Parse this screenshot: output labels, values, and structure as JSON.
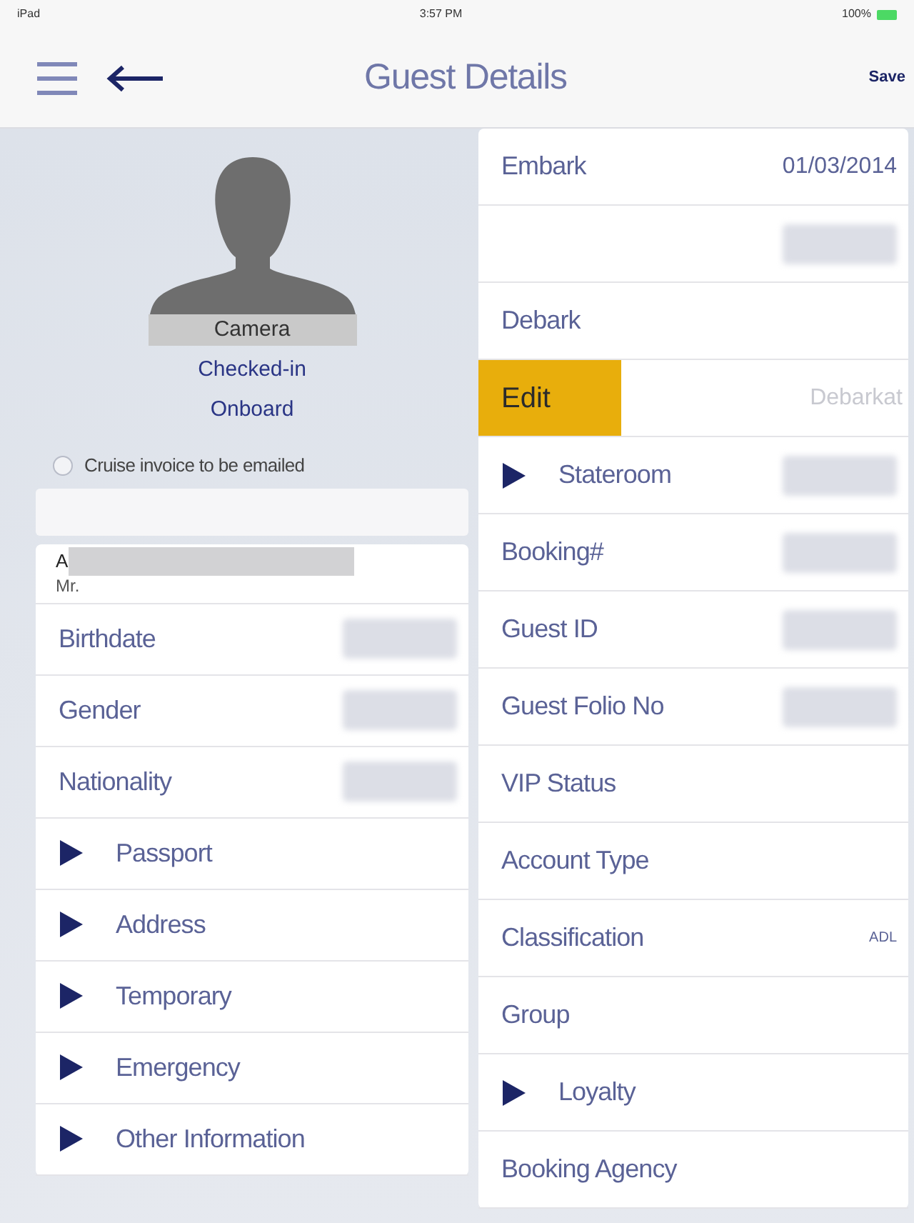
{
  "status_bar": {
    "device": "iPad",
    "time": "3:57 PM",
    "battery": "100%"
  },
  "nav_bar": {
    "title": "Guest Details",
    "save": "Save"
  },
  "profile": {
    "camera": "Camera",
    "statuses": [
      "Checked-in",
      "Onboard"
    ],
    "invoice_option": {
      "label": "Cruise invoice to be emailed",
      "checked": false
    }
  },
  "guest_name": {
    "name": "A",
    "redacted": true,
    "title": "Mr."
  },
  "left_rows": [
    {
      "kind": "field",
      "label": "Birthdate",
      "redacted": true
    },
    {
      "kind": "field",
      "label": "Gender",
      "redacted": true
    },
    {
      "kind": "field",
      "label": "Nationality",
      "redacted": true
    },
    {
      "kind": "expander",
      "label": "Passport",
      "expanded": false
    },
    {
      "kind": "expander",
      "label": "Address",
      "expanded": false
    },
    {
      "kind": "expander",
      "label": "Temporary",
      "expanded": false
    },
    {
      "kind": "expander",
      "label": "Emergency",
      "expanded": false
    },
    {
      "kind": "expander",
      "label": "Other Information",
      "expanded": false
    }
  ],
  "right_rows": [
    {
      "kind": "field",
      "label": "Embark",
      "value": "01/03/2014"
    },
    {
      "kind": "field",
      "redacted": true
    },
    {
      "kind": "field",
      "label": "Debark"
    },
    {
      "kind": "edit",
      "action": "Edit",
      "value": "Debarkat"
    },
    {
      "kind": "expander",
      "label": "Stateroom",
      "expanded": false,
      "redacted": true
    },
    {
      "kind": "field",
      "label": "Booking#",
      "redacted": true
    },
    {
      "kind": "field",
      "label": "Guest ID",
      "redacted": true
    },
    {
      "kind": "field",
      "label": "Guest Folio No",
      "redacted": true
    },
    {
      "kind": "field",
      "label": "VIP Status"
    },
    {
      "kind": "field",
      "label": "Account Type"
    },
    {
      "kind": "field",
      "label": "Classification",
      "value": "ADL"
    },
    {
      "kind": "field",
      "label": "Group"
    },
    {
      "kind": "expander",
      "label": "Loyalty",
      "expanded": false
    },
    {
      "kind": "field",
      "label": "Booking Agency"
    }
  ]
}
